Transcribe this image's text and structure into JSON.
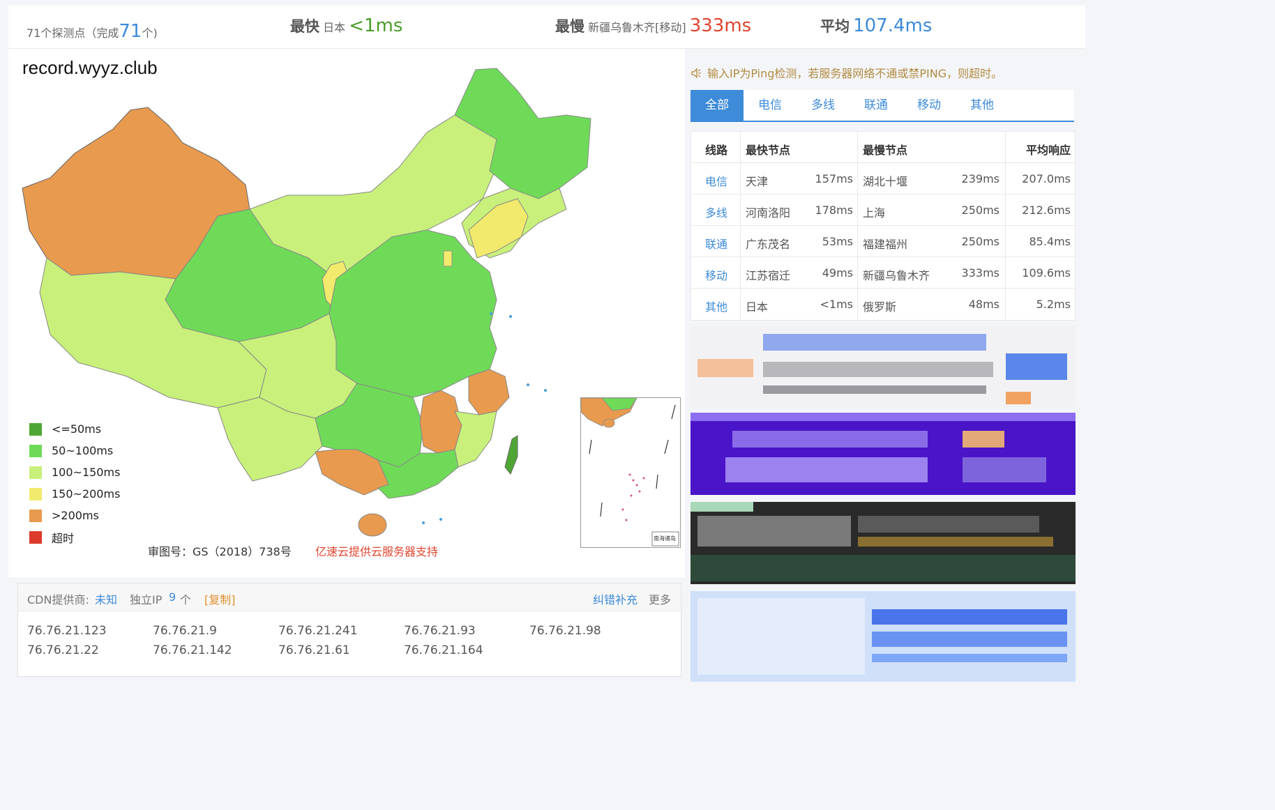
{
  "summary": {
    "probe_prefix": "71个探测点（完成",
    "probe_done": "71",
    "probe_suffix": "个)",
    "fastest_label": "最快",
    "fastest_loc": "日本",
    "fastest_val": "<1ms",
    "slowest_label": "最慢",
    "slowest_loc": "新疆乌鲁木齐[移动]",
    "slowest_val": "333ms",
    "avg_label": "平均",
    "avg_val": "107.4ms"
  },
  "map": {
    "domain": "record.wyyz.club",
    "review_no": "审图号：GS（2018）738号",
    "sponsor": "亿速云提供云服务器支持",
    "legend": [
      {
        "label": "<=50ms",
        "color": "#4ea634"
      },
      {
        "label": "50~100ms",
        "color": "#6fda58"
      },
      {
        "label": "100~150ms",
        "color": "#c8f07a"
      },
      {
        "label": "150~200ms",
        "color": "#f2ea6c"
      },
      {
        "label": ">200ms",
        "color": "#e89a4e"
      },
      {
        "label": "超时",
        "color": "#dc3a2a"
      }
    ],
    "inset_label": "南海诸岛"
  },
  "cdn": {
    "provider_label": "CDN提供商:",
    "provider_value": "未知",
    "ip_label": "独立IP",
    "ip_count": "9",
    "ip_unit": "个",
    "copy": "[复制]",
    "correct": "纠错补充",
    "more": "更多",
    "ips": [
      "76.76.21.123",
      "76.76.21.9",
      "76.76.21.241",
      "76.76.21.93",
      "76.76.21.98",
      "76.76.21.22",
      "76.76.21.142",
      "76.76.21.61",
      "76.76.21.164"
    ]
  },
  "notice": {
    "icon": "speaker-icon",
    "text": "输入IP为Ping检测，若服务器网络不通或禁PING，则超时。"
  },
  "tabs": [
    "全部",
    "电信",
    "多线",
    "联通",
    "移动",
    "其他"
  ],
  "table": {
    "headers": [
      "线路",
      "最快节点",
      "最慢节点",
      "平均响应"
    ],
    "rows": [
      {
        "isp": "电信",
        "fast_node": "天津",
        "fast_ms": "157ms",
        "slow_node": "湖北十堰",
        "slow_ms": "239ms",
        "avg": "207.0ms"
      },
      {
        "isp": "多线",
        "fast_node": "河南洛阳",
        "fast_ms": "178ms",
        "slow_node": "上海",
        "slow_ms": "250ms",
        "avg": "212.6ms"
      },
      {
        "isp": "联通",
        "fast_node": "广东茂名",
        "fast_ms": "53ms",
        "slow_node": "福建福州",
        "slow_ms": "250ms",
        "avg": "85.4ms"
      },
      {
        "isp": "移动",
        "fast_node": "江苏宿迁",
        "fast_ms": "49ms",
        "slow_node": "新疆乌鲁木齐",
        "slow_ms": "333ms",
        "avg": "109.6ms"
      },
      {
        "isp": "其他",
        "fast_node": "日本",
        "fast_ms": "<1ms",
        "slow_node": "俄罗斯",
        "slow_ms": "48ms",
        "avg": "5.2ms"
      }
    ]
  }
}
